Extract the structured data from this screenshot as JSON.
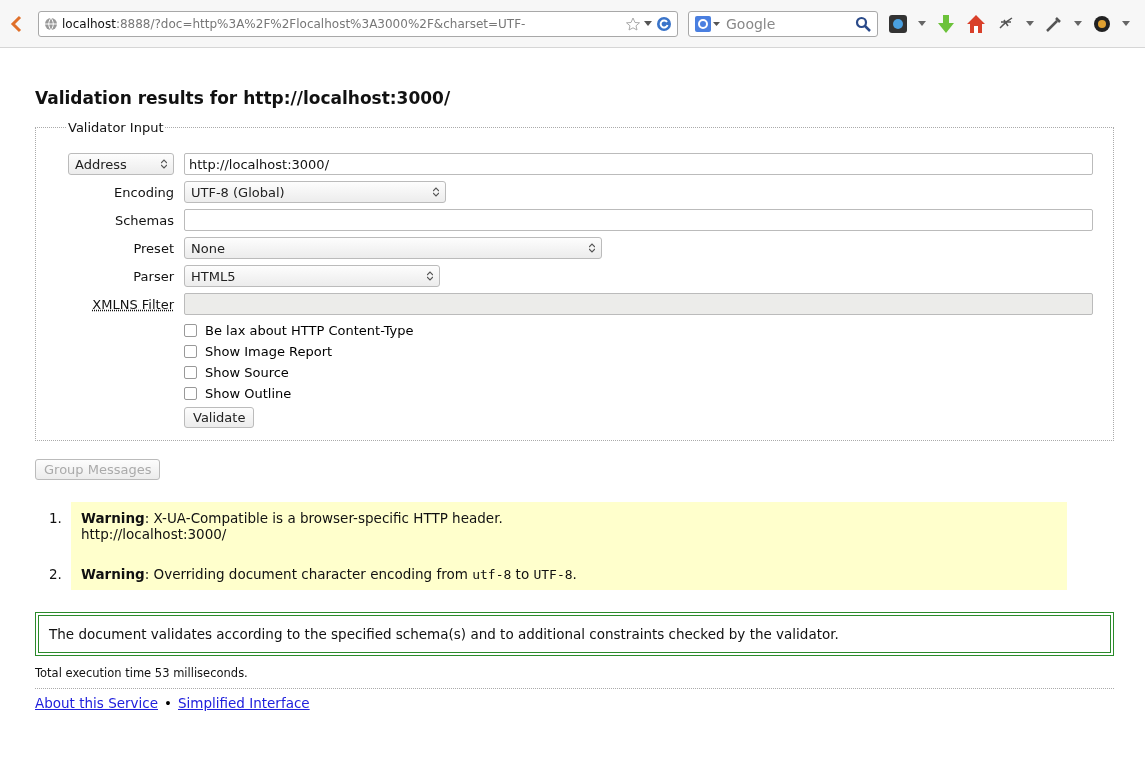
{
  "browser": {
    "url_host": "localhost",
    "url_rest": ":8888/?doc=http%3A%2F%2Flocalhost%3A3000%2F&charset=UTF-",
    "search_placeholder": "Google"
  },
  "title": "Validation results for http://localhost:3000/",
  "fieldset": {
    "legend": "Validator Input",
    "rows": [
      {
        "kind": "select-label",
        "label": "Address",
        "value": "http://localhost:3000/"
      },
      {
        "kind": "select",
        "label": "Encoding",
        "value": "UTF-8 (Global)"
      },
      {
        "kind": "input",
        "label": "Schemas"
      },
      {
        "kind": "select",
        "label": "Preset",
        "value": "None"
      },
      {
        "kind": "select",
        "label": "Parser",
        "value": "HTML5"
      },
      {
        "kind": "disabled",
        "label": "XMLNS Filter"
      }
    ],
    "checkboxes": [
      {
        "label": "Be lax about HTTP Content-Type",
        "checked": false
      },
      {
        "label": "Show Image Report",
        "checked": false
      },
      {
        "label": "Show Source",
        "checked": false
      },
      {
        "label": "Show Outline",
        "checked": false
      }
    ],
    "submit": "Validate"
  },
  "group_button": {
    "label": "Group Messages",
    "disabled": true
  },
  "messages": [
    {
      "number": "1.",
      "parts": [
        {
          "kind": "bold",
          "text": "Warning"
        },
        {
          "kind": "text",
          "text": ": X-UA-Compatible is a browser-specific HTTP header."
        }
      ],
      "location": "http://localhost:3000/"
    },
    {
      "number": "2.",
      "parts": [
        {
          "kind": "bold",
          "text": "Warning"
        },
        {
          "kind": "text",
          "text": ": Overriding document character encoding from "
        },
        {
          "kind": "code",
          "text": "utf-8"
        },
        {
          "kind": "text",
          "text": " to "
        },
        {
          "kind": "code",
          "text": "UTF-8"
        },
        {
          "kind": "text",
          "text": "."
        }
      ]
    }
  ],
  "success": "The document validates according to the specified schema(s) and to additional constraints checked by the validator.",
  "timing": "Total execution time 53 milliseconds.",
  "footer": {
    "links": [
      "About this Service",
      "Simplified Interface"
    ],
    "separator": "•"
  }
}
